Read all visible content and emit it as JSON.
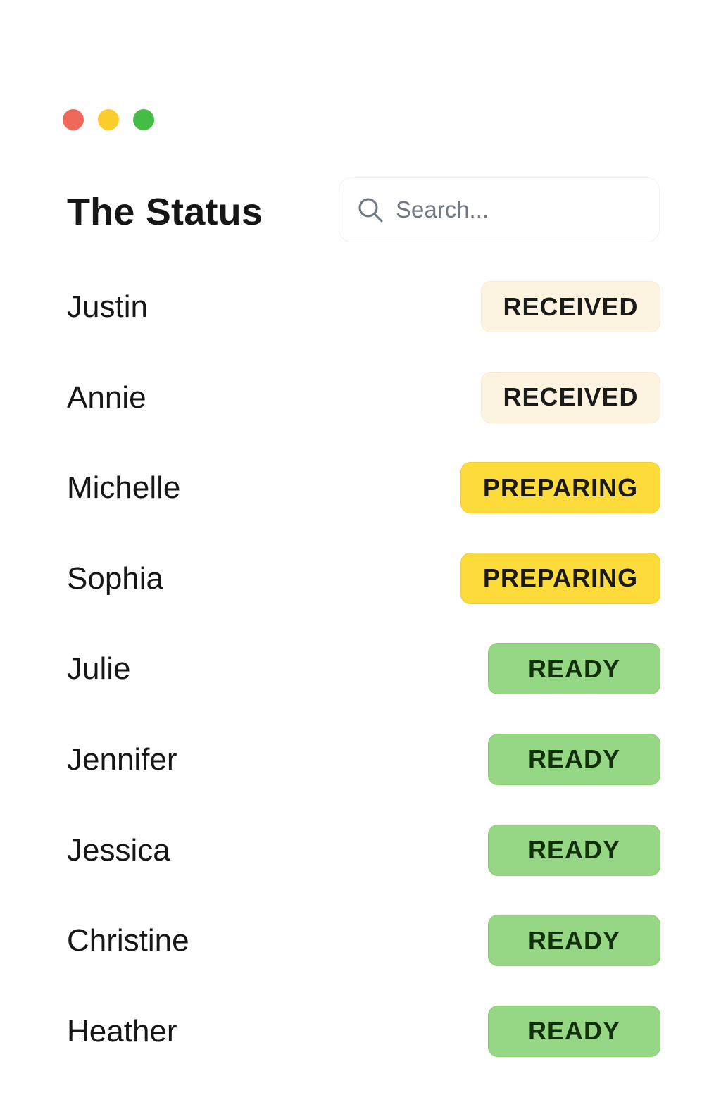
{
  "window": {
    "controls": [
      {
        "name": "close",
        "color": "#f0685a"
      },
      {
        "name": "minimize",
        "color": "#fbcc2d"
      },
      {
        "name": "zoom",
        "color": "#45bd44"
      }
    ]
  },
  "header": {
    "title": "The Status",
    "search": {
      "placeholder": "Search...",
      "value": ""
    }
  },
  "status_colors": {
    "RECEIVED": "#fdf3e1",
    "PREPARING": "#fddb3a",
    "READY": "#95d784"
  },
  "orders": [
    {
      "name": "Justin",
      "status": "RECEIVED"
    },
    {
      "name": "Annie",
      "status": "RECEIVED"
    },
    {
      "name": "Michelle",
      "status": "PREPARING"
    },
    {
      "name": "Sophia",
      "status": "PREPARING"
    },
    {
      "name": "Julie",
      "status": "READY"
    },
    {
      "name": "Jennifer",
      "status": "READY"
    },
    {
      "name": "Jessica",
      "status": "READY"
    },
    {
      "name": "Christine",
      "status": "READY"
    },
    {
      "name": "Heather",
      "status": "READY"
    }
  ]
}
